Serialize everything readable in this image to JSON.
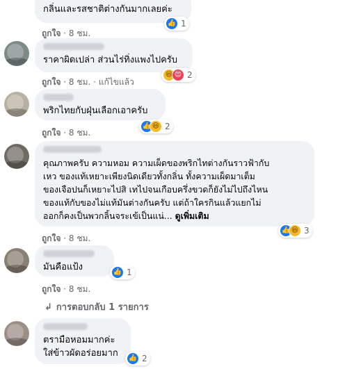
{
  "comments": [
    {
      "text": "กลิ่นและรสชาติต่างกันมากเลยค่ะ",
      "actions": {
        "like": "ถูกใจ",
        "time": "8 ชม.",
        "edited": ""
      },
      "reaction_count": "1",
      "reactions": [
        "like"
      ]
    },
    {
      "text": "ราคาผิดเปล่า ส่วนไร่ทิ่งแพงไปครับ",
      "actions": {
        "like": "ถูกใจ",
        "time": "8 ชม.",
        "edited": "แก้ไขแล้ว"
      },
      "reaction_count": "2",
      "reactions": [
        "haha",
        "love"
      ]
    },
    {
      "text": "พริกไทยกับฝุ่นเลือกเอาครับ",
      "actions": {
        "like": "ถูกใจ",
        "time": "8 ชม.",
        "edited": ""
      },
      "reaction_count": "2",
      "reactions": [
        "like",
        "haha"
      ]
    },
    {
      "text": "คุณภาพครับ ความหอม ความเผ็ดของพริกไทต่างกันราวฟ้ากับ\nเหว ของแท้เหยาะเพียงนิดเดียวทั้งกลิ่น ทั้งความเผ็ดมาเต็ม\nของเจือปนก็เหยาะไปสิ เทไปจนเกือบครึ่งขวดก็ยังไม่ไปถึงไหน\nของแท้กับของไม่แท้มันต่างกันครับ แต่ถ้าใครกินแล้วแยกไม่\nออกก็คงเป็นพวกลิ้นจระเข้เป็นแน่...",
      "see_more": "ดูเพิ่มเติม",
      "actions": {
        "like": "ถูกใจ",
        "time": "8 ชม.",
        "edited": ""
      },
      "reaction_count": "3",
      "reactions": [
        "like",
        "haha"
      ]
    },
    {
      "text": "มันคือแป้ง",
      "actions": {
        "like": "ถูกใจ",
        "time": "8 ชม.",
        "edited": ""
      },
      "reaction_count": "1",
      "reactions": [
        "like"
      ],
      "replies": "การตอบกลับ 1 รายการ"
    },
    {
      "text": "ตรามือหอมมากค่ะ\nใส่ข้าวผัดอร่อยมาก",
      "actions": {
        "like": "",
        "time": "",
        "edited": ""
      },
      "reaction_count": "2",
      "reactions": [
        "like"
      ]
    }
  ],
  "symbols": {
    "dot": "·",
    "like_glyph": "👍",
    "haha_glyph": "😆",
    "love_glyph": "😍",
    "reply_arrow": "↳"
  }
}
